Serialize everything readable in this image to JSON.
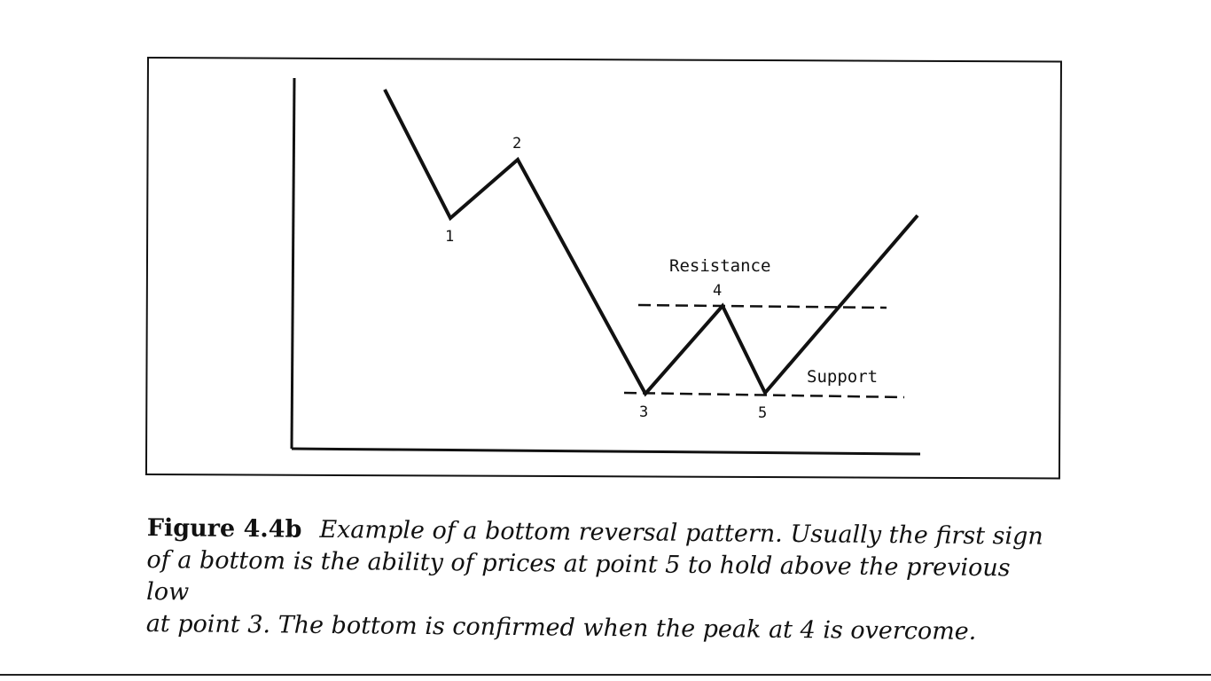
{
  "figure": {
    "labels": {
      "points": [
        "1",
        "2",
        "3",
        "4",
        "5"
      ],
      "resistance": "Resistance",
      "support": "Support"
    },
    "caption": {
      "id": "Figure 4.4b",
      "text_lines": [
        "Example of a bottom reversal pattern. Usually the first sign",
        "of a bottom is the ability of prices at point 5 to hold above the previous low",
        "at point 3. The bottom is confirmed when the peak at 4 is overcome."
      ]
    },
    "line_style": {
      "price_line": "solid",
      "resistance": "dashed",
      "support": "dashed"
    },
    "colors": {
      "ink": "#111111",
      "background": "#ffffff"
    }
  }
}
